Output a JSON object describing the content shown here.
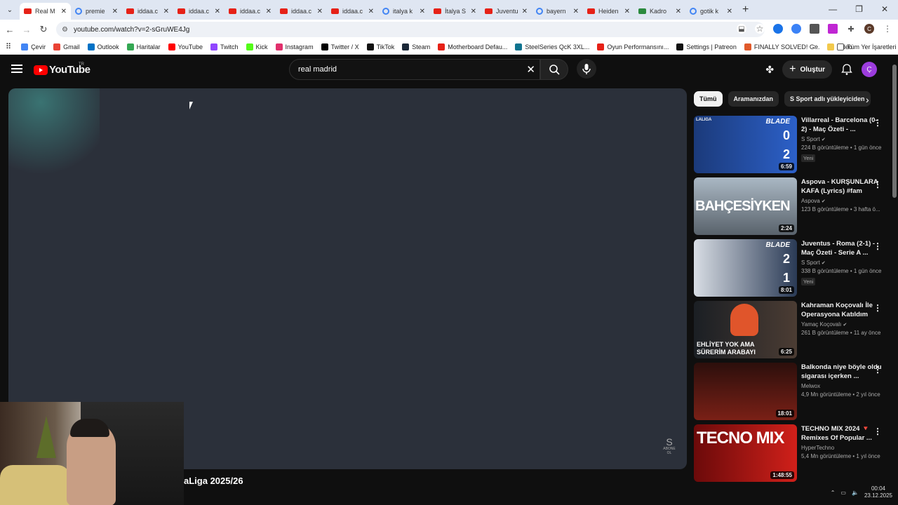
{
  "browser": {
    "tabs": [
      {
        "label": "Real M",
        "icon": "yt",
        "active": true
      },
      {
        "label": "premie",
        "icon": "g"
      },
      {
        "label": "iddaa.c",
        "icon": "yt"
      },
      {
        "label": "iddaa.c",
        "icon": "yt"
      },
      {
        "label": "iddaa.c",
        "icon": "yt"
      },
      {
        "label": "iddaa.c",
        "icon": "yt"
      },
      {
        "label": "iddaa.c",
        "icon": "yt"
      },
      {
        "label": "italya k",
        "icon": "g"
      },
      {
        "label": "İtalya S",
        "icon": "yt"
      },
      {
        "label": "Juventu",
        "icon": "yt"
      },
      {
        "label": "bayern",
        "icon": "g"
      },
      {
        "label": "Heiden",
        "icon": "yt"
      },
      {
        "label": "Kadro",
        "icon": "nv"
      },
      {
        "label": "gotik k",
        "icon": "g"
      }
    ],
    "url": "youtube.com/watch?v=2-sGruWE4Jg",
    "bookmarks": [
      "Çevir",
      "Gmail",
      "Outlook",
      "Haritalar",
      "YouTube",
      "Twitch",
      "Kick",
      "Instagram",
      "Twitter / X",
      "TikTok",
      "Steam",
      "Motherboard Defau...",
      "SteelSeries QcK 3XL...",
      "Oyun Performansını...",
      "Settings | Patreon",
      "FINALLY SOLVED! G...",
      "video"
    ],
    "bookmark_colors": [
      "#4285f4",
      "#ea4335",
      "#0072c6",
      "#34a853",
      "#ff0000",
      "#9146ff",
      "#53fc18",
      "#e1306c",
      "#000000",
      "#111111",
      "#1b2838",
      "#e62117",
      "#0e7490",
      "#e62117",
      "#111111",
      "#e05a2b",
      "#f2c94c"
    ],
    "bookmarks_overflow": "»",
    "all_bookmarks": "Tüm Yer İşaretleri"
  },
  "youtube": {
    "logo_text": "YouTube",
    "country_code": "TR",
    "search_value": "real madrid",
    "create_label": "Oluştur",
    "avatar_letter": "Ç",
    "video_title_partial": "aLiga 2025/26",
    "watermark": "ABONE OL",
    "chips": [
      "Tümü",
      "Aramanızdan",
      "S Sport adlı yükleyiciden"
    ],
    "recommendations": [
      {
        "title": "Villarreal - Barcelona (0-2) - Maç Özeti - ...",
        "channel": "S Sport",
        "verified": true,
        "meta": "224 B görüntüleme • 1 gün önce",
        "badge": "Yeni",
        "duration": "6:59",
        "thumb": "th1"
      },
      {
        "title": "Aspova - KURŞUNLARA KAFA (Lyrics) #fam",
        "channel": "Aspova",
        "verified": true,
        "meta": "123 B görüntüleme • 3 hafta ö...",
        "badge": "",
        "duration": "2:24",
        "thumb": "th2"
      },
      {
        "title": "Juventus - Roma (2-1) - Maç Özeti - Serie A ...",
        "channel": "S Sport",
        "verified": true,
        "meta": "338 B görüntüleme • 1 gün önce",
        "badge": "Yeni",
        "duration": "8:01",
        "thumb": "th3"
      },
      {
        "title": "Kahraman Koçovalı İle Operasyona Katıldım",
        "channel": "Yamaç Koçovalı",
        "verified": true,
        "meta": "261 B görüntüleme • 11 ay önce",
        "badge": "",
        "duration": "6:25",
        "thumb": "th4"
      },
      {
        "title": "Balkonda niye böyle oldu sigarası içerken ...",
        "channel": "Melwox",
        "verified": false,
        "meta": "4,9 Mn görüntüleme • 2 yıl önce",
        "badge": "",
        "duration": "18:01",
        "thumb": "th5"
      },
      {
        "title": "TECHNO MIX 2024 🔻 Remixes Of Popular ...",
        "channel": "HyperTechno",
        "verified": false,
        "meta": "5,4 Mn görüntüleme • 1 yıl önce",
        "badge": "",
        "duration": "1:48:55",
        "thumb": "th6"
      }
    ],
    "thumb_texts": {
      "blade": "BLADE",
      "laliga": "LALIGA",
      "score1": [
        "0",
        "2"
      ],
      "bahcesiyken": "BAHÇESİYKEN",
      "score3": [
        "2",
        "1"
      ],
      "ehliyet": "EHLİYET YOK AMA SÜRERİM ARABAYI",
      "techno": "TECNO MIX"
    }
  },
  "taskbar": {
    "time": "00:04",
    "date": "23.12.2025"
  }
}
